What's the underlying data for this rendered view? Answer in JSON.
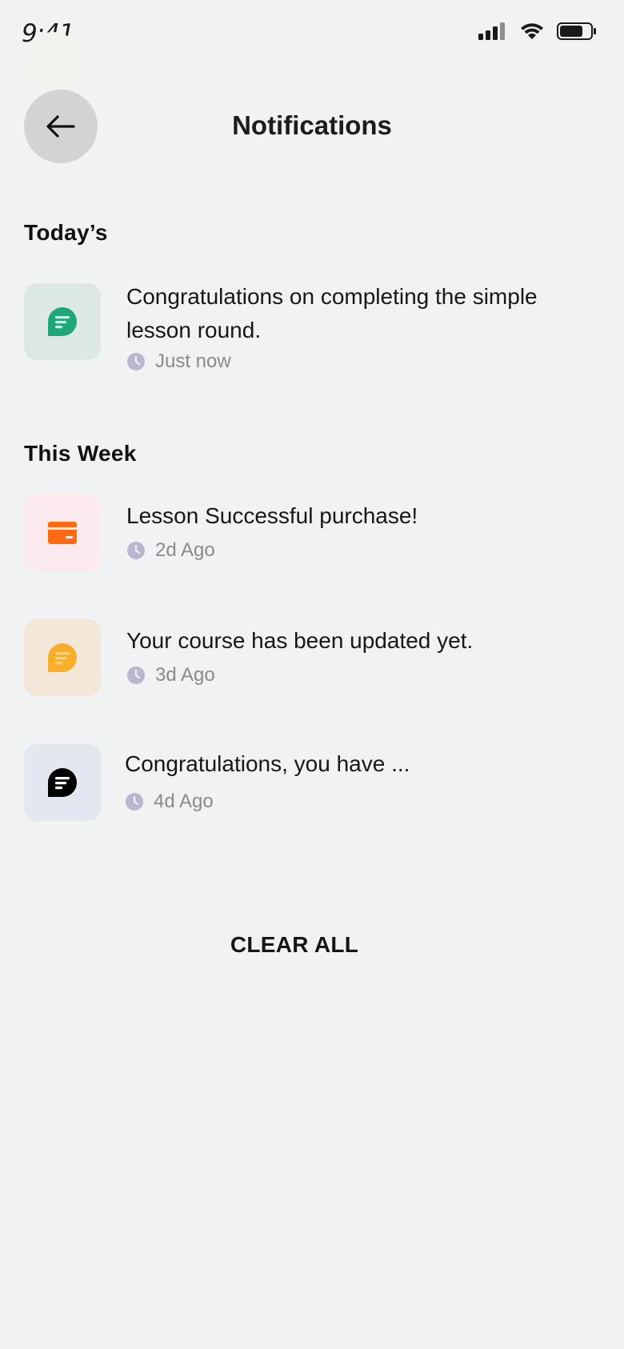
{
  "status_bar": {
    "time": "9:41"
  },
  "header": {
    "title": "Notifications",
    "back_icon": "arrow-left-icon"
  },
  "sections": [
    {
      "heading": "Today’s",
      "items": [
        {
          "text": "Congratulations on completing the simple lesson round.",
          "time": "Just now",
          "icon": "chat-bubble-icon",
          "icon_color": "#1FA67D",
          "icon_bg": "#DCE8E5"
        }
      ]
    },
    {
      "heading": "This Week",
      "items": [
        {
          "text": "Lesson Successful purchase!",
          "time": "2d Ago",
          "icon": "credit-card-icon",
          "icon_color": "#FF6A13",
          "icon_bg": "#FCEBEE"
        },
        {
          "text": "Your course has been updated yet.",
          "time": "3d Ago",
          "icon": "chat-bubble-icon",
          "icon_color": "#F9AE2B",
          "icon_bg": "#F2E7D8"
        },
        {
          "text": "Congratulations, you have ...",
          "time": "4d Ago",
          "icon": "chat-bubble-icon",
          "icon_color": "#000000",
          "icon_bg": "#E3E8F0"
        }
      ]
    }
  ],
  "clear_all_label": "CLEAR ALL",
  "colors": {
    "background": "#F1F2F4",
    "clock": "#B9B7CF",
    "time_text": "#8A8A8E"
  }
}
